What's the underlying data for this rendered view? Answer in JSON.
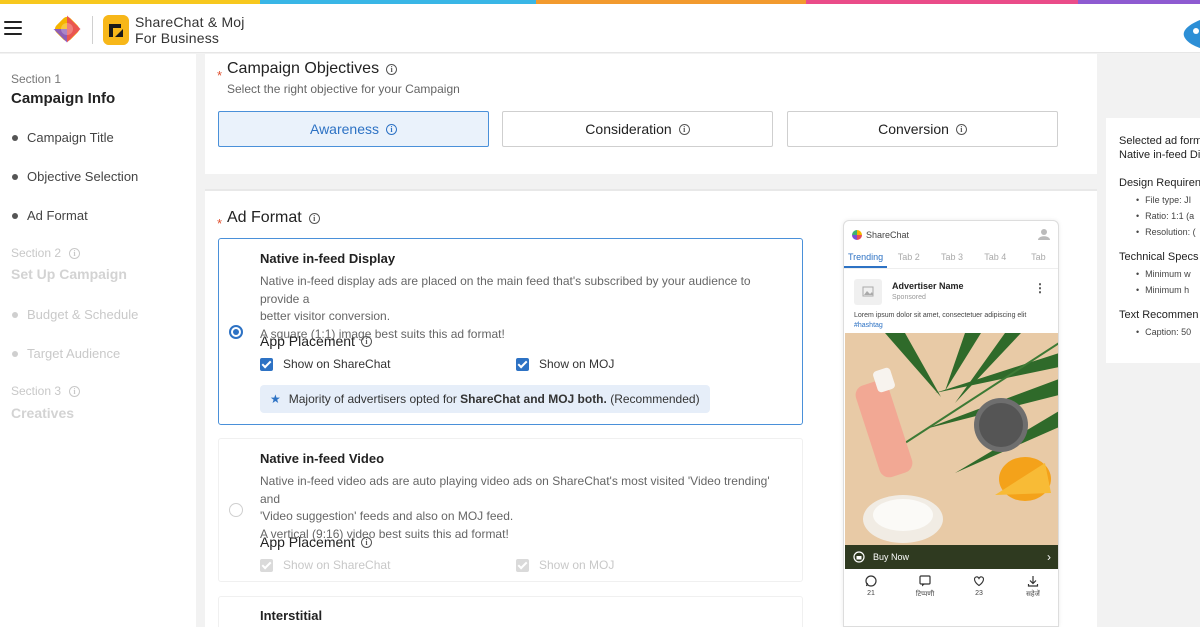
{
  "brand": {
    "line1": "ShareChat & Moj",
    "line2": "For Business"
  },
  "colors": {
    "accent": "#2d72c4",
    "required": "#e0502f",
    "rainbow": [
      "#f7c81e",
      "#39b6e6",
      "#f29a2e",
      "#ea4c89",
      "#8e5bd1"
    ]
  },
  "sidebar": {
    "sections": [
      {
        "label": "Section 1",
        "title": "Campaign Info",
        "items": [
          "Campaign Title",
          "Objective Selection",
          "Ad Format"
        ]
      },
      {
        "label": "Section 2",
        "title": "Set Up Campaign",
        "items": [
          "Budget & Schedule",
          "Target Audience"
        ]
      },
      {
        "label": "Section 3",
        "title": "Creatives",
        "items": []
      }
    ]
  },
  "objectives": {
    "title": "Campaign Objectives",
    "subtitle": "Select the right objective for your Campaign",
    "options": [
      "Awareness",
      "Consideration",
      "Conversion"
    ],
    "selected": "Awareness"
  },
  "ad_format": {
    "title": "Ad Format",
    "cards": [
      {
        "title": "Native in-feed Display",
        "desc1": "Native in-feed display ads are placed on the main feed that's subscribed by your audience to provide a",
        "desc2": "better visitor conversion.",
        "desc3": "A square (1:1) image best suits this ad format!",
        "placement_title": "App Placement",
        "opt1": "Show on ShareChat",
        "opt2": "Show on MOJ",
        "note_pre": "Majority of advertisers opted for ",
        "note_bold": "ShareChat and MOJ both.",
        "note_post": " (Recommended)"
      },
      {
        "title": "Native in-feed Video",
        "desc1": "Native in-feed video ads are auto playing video ads on ShareChat's most visited 'Video trending' and",
        "desc2": "'Video suggestion' feeds and also on MOJ feed.",
        "desc3": "A vertical (9:16) video best suits this ad format!",
        "placement_title": "App Placement",
        "opt1": "Show on ShareChat",
        "opt2": "Show on MOJ"
      },
      {
        "title": "Interstitial"
      }
    ]
  },
  "preview": {
    "brand": "ShareChat",
    "tabs": [
      "Trending",
      "Tab 2",
      "Tab 3",
      "Tab 4",
      "Tab"
    ],
    "advertiser": "Advertiser Name",
    "sponsored": "Sponsored",
    "caption": "Lorem ipsum dolor sit amet, consectetuer adipiscing elit",
    "hashtag": "#hashtag",
    "cta": "Buy Now",
    "bar": [
      {
        "icon": "whatsapp-icon",
        "label": "21"
      },
      {
        "icon": "comment-icon",
        "label": "टिप्पणी"
      },
      {
        "icon": "heart-icon",
        "label": "23"
      },
      {
        "icon": "download-icon",
        "label": "सहेजें"
      }
    ]
  },
  "right_panel": {
    "selected_label": "Selected ad form",
    "selected_value": "Native in-feed Di",
    "design_title": "Design Requiren",
    "design_items": [
      "File type: JI",
      "Ratio: 1:1 (a",
      "Resolution: ("
    ],
    "tech_title": "Technical Specs",
    "tech_items": [
      "Minimum w",
      "Minimum h"
    ],
    "text_title": "Text Recommen",
    "text_items": [
      "Caption: 50"
    ]
  }
}
